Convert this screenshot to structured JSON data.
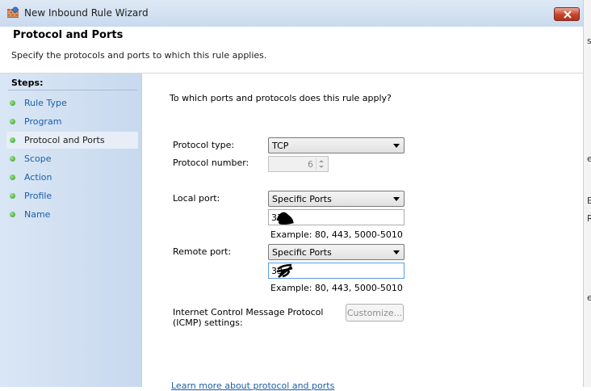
{
  "window": {
    "title": "New Inbound Rule Wizard",
    "close_icon": "close-icon"
  },
  "header": {
    "title": "Protocol and Ports",
    "subtitle": "Specify the protocols and ports to which this rule applies."
  },
  "sidebar": {
    "steps_label": "Steps:",
    "items": [
      {
        "label": "Rule Type",
        "active": false
      },
      {
        "label": "Program",
        "active": false
      },
      {
        "label": "Protocol and Ports",
        "active": true
      },
      {
        "label": "Scope",
        "active": false
      },
      {
        "label": "Action",
        "active": false
      },
      {
        "label": "Profile",
        "active": false
      },
      {
        "label": "Name",
        "active": false
      }
    ]
  },
  "main": {
    "question": "To which ports and protocols does this rule apply?",
    "protocol_type_label": "Protocol type:",
    "protocol_type_value": "TCP",
    "protocol_number_label": "Protocol number:",
    "protocol_number_value": "6",
    "local_port_label": "Local port:",
    "local_port_mode": "Specific Ports",
    "local_port_value": "33",
    "local_port_example": "Example: 80, 443, 5000-5010",
    "remote_port_label": "Remote port:",
    "remote_port_mode": "Specific Ports",
    "remote_port_value": "33",
    "remote_port_example": "Example: 80, 443, 5000-5010",
    "icmp_label_line1": "Internet Control Message Protocol",
    "icmp_label_line2": "(ICMP) settings:",
    "customize_label": "Customize...",
    "learn_more_link": "Learn more about protocol and ports"
  },
  "background_window": {
    "fragments": [
      "s",
      "e",
      "E",
      "R",
      "e"
    ]
  }
}
